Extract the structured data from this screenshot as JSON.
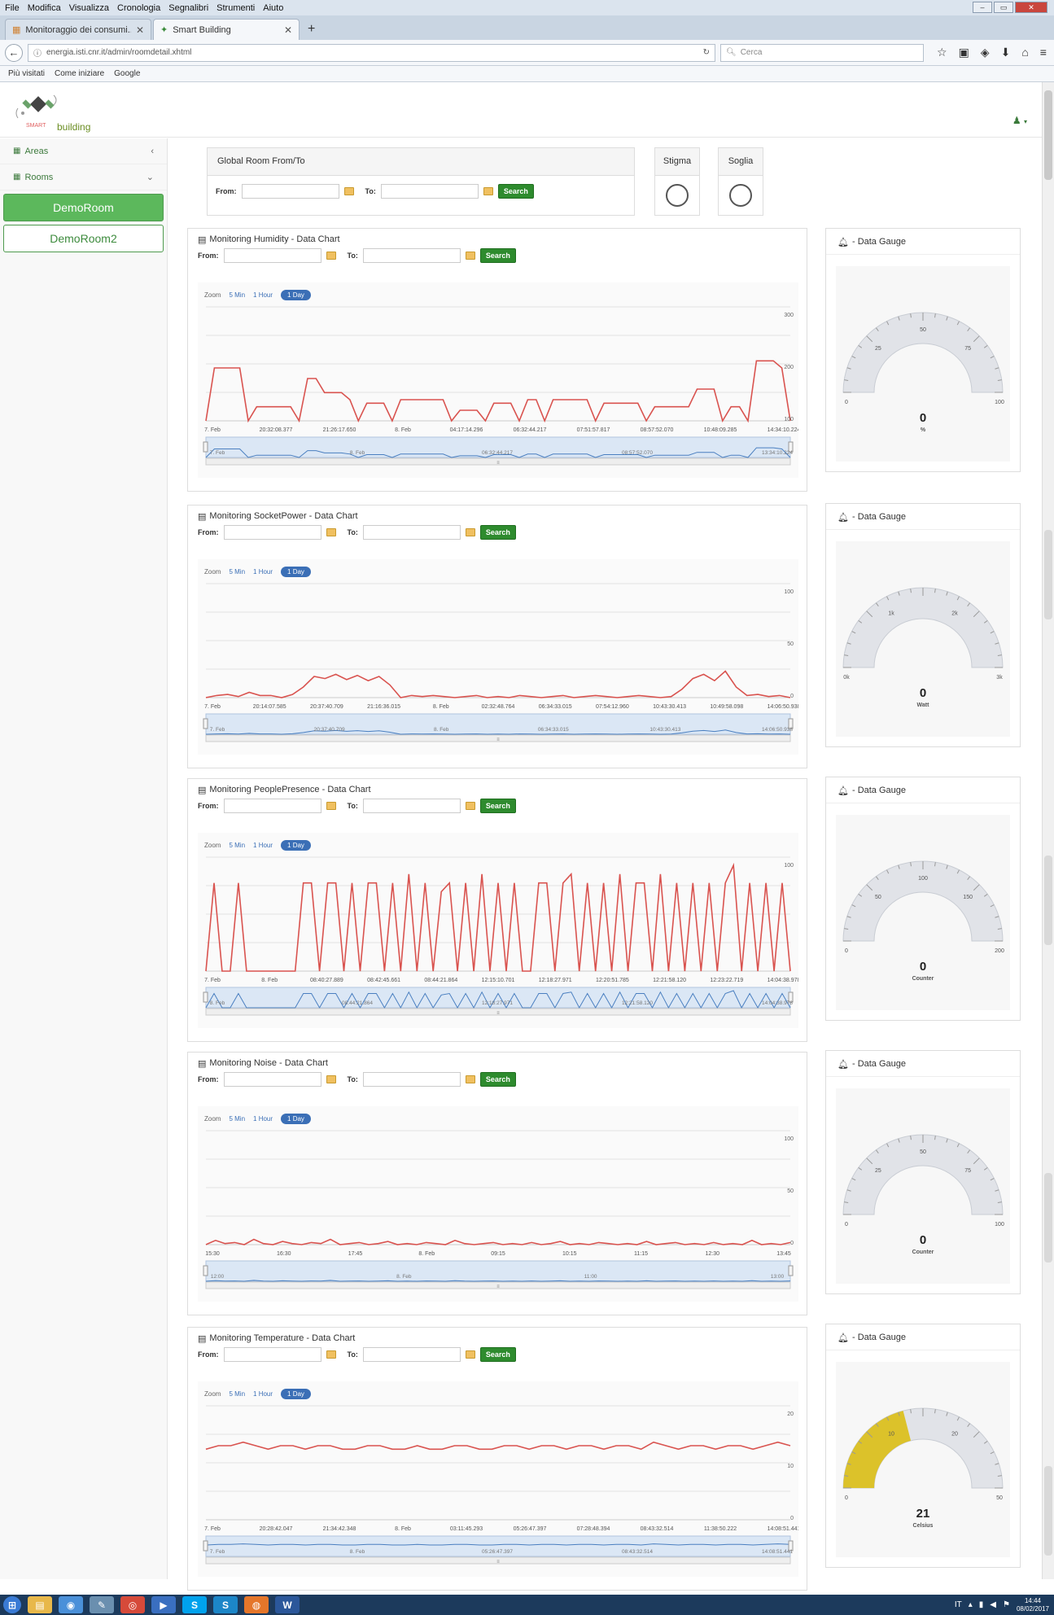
{
  "browser": {
    "menu": [
      "File",
      "Modifica",
      "Visualizza",
      "Cronologia",
      "Segnalibri",
      "Strumenti",
      "Aiuto"
    ],
    "tabs": [
      {
        "label": "Monitoraggio dei consumi...",
        "icon": "grid-icon"
      },
      {
        "label": "Smart Building",
        "icon": "tree-icon"
      }
    ],
    "url": "energia.isti.cnr.it/admin/roomdetail.xhtml",
    "search_placeholder": "Cerca",
    "bookmarks": [
      "Più visitati",
      "Come iniziare",
      "Google"
    ]
  },
  "app": {
    "logo_word": "building",
    "logo_smart": "SMART"
  },
  "sidebar": {
    "areas_label": "Areas",
    "rooms_label": "Rooms",
    "rooms": [
      "DemoRoom",
      "DemoRoom2"
    ]
  },
  "global": {
    "title": "Global Room From/To",
    "from_label": "From:",
    "to_label": "To:",
    "search_label": "Search",
    "stigma_label": "Stigma",
    "soglia_label": "Soglia"
  },
  "zoom": {
    "label": "Zoom",
    "options": [
      "5 Min",
      "1 Hour",
      "1 Day"
    ],
    "selected": "1 Day"
  },
  "panels": [
    {
      "title": "Monitoring Humidity - Data Chart",
      "gauge_title": "- Data Gauge",
      "yticks": [
        "300",
        "200",
        "100"
      ],
      "xticks": [
        "7. Feb",
        "20:32:08.377",
        "21:26:17.650",
        "8. Feb",
        "04:17:14.296",
        "06:32:44.217",
        "07:51:57.817",
        "08:57:52.070",
        "10:48:09.285",
        "14:34:10.224"
      ],
      "nav_labels": [
        "7. Feb",
        "8. Feb",
        "06:32:44.217",
        "08:57:52.070",
        "13:34:10.224"
      ],
      "gauge": {
        "value": "0",
        "unit": "%",
        "min": "0",
        "max": "100",
        "ticks": [
          "25",
          "50",
          "75"
        ],
        "fill": 0
      }
    },
    {
      "title": "Monitoring SocketPower - Data Chart",
      "gauge_title": "- Data Gauge",
      "yticks": [
        "100",
        "50",
        "0"
      ],
      "xticks": [
        "7. Feb",
        "20:14:07.585",
        "20:37:40.709",
        "21:16:36.015",
        "8. Feb",
        "02:32:48.764",
        "06:34:33.015",
        "07:54:12.960",
        "10:43:30.413",
        "10:49:58.098",
        "14:06:50.938"
      ],
      "nav_labels": [
        "7. Feb",
        "20:37:40.709",
        "8. Feb",
        "06:34:33.015",
        "10:43:30.413",
        "14:06:50.938"
      ],
      "gauge": {
        "value": "0",
        "unit": "Watt",
        "min": "0k",
        "max": "3k",
        "ticks": [
          "1k",
          "2k"
        ],
        "fill": 0
      }
    },
    {
      "title": "Monitoring PeoplePresence - Data Chart",
      "gauge_title": "- Data Gauge",
      "yticks": [
        "100"
      ],
      "xticks": [
        "7. Feb",
        "8. Feb",
        "08:40:27.889",
        "08:42:45.661",
        "08:44:21.864",
        "12:15:10.701",
        "12:18:27.971",
        "12:20:51.785",
        "12:21:58.120",
        "12:23:22.719",
        "14:04:38.978"
      ],
      "nav_labels": [
        "8. Feb",
        "08:44:21.864",
        "12:18:27.971",
        "12:21:58.120",
        "14:04:38.978"
      ],
      "gauge": {
        "value": "0",
        "unit": "Counter",
        "min": "0",
        "max": "200",
        "ticks": [
          "50",
          "100",
          "150"
        ],
        "fill": 0
      }
    },
    {
      "title": "Monitoring Noise - Data Chart",
      "gauge_title": "- Data Gauge",
      "yticks": [
        "100",
        "50",
        "0"
      ],
      "xticks": [
        "15:30",
        "16:30",
        "17:45",
        "8. Feb",
        "09:15",
        "10:15",
        "11:15",
        "12:30",
        "13:45"
      ],
      "nav_labels": [
        "12:00",
        "8. Feb",
        "11:00",
        "13:00"
      ],
      "gauge": {
        "value": "0",
        "unit": "Counter",
        "min": "0",
        "max": "100",
        "ticks": [
          "25",
          "50",
          "75"
        ],
        "fill": 0
      }
    },
    {
      "title": "Monitoring Temperature - Data Chart",
      "gauge_title": "- Data Gauge",
      "yticks": [
        "20",
        "10",
        "0"
      ],
      "xticks": [
        "7. Feb",
        "20:28:42.047",
        "21:34:42.348",
        "8. Feb",
        "03:11:45.293",
        "05:26:47.397",
        "07:28:48.394",
        "08:43:32.514",
        "11:38:50.222",
        "14:08:51.441"
      ],
      "nav_labels": [
        "7. Feb",
        "8. Feb",
        "05:26:47.397",
        "08:43:32.514",
        "14:08:51.441"
      ],
      "gauge": {
        "value": "21",
        "unit": "Celsius",
        "min": "0",
        "max": "50",
        "ticks": [
          "10",
          "20"
        ],
        "fill": 0.42
      }
    }
  ],
  "chart_data": [
    {
      "type": "line",
      "title": "Monitoring Humidity - Data Chart",
      "ylim": [
        0,
        300
      ],
      "series": [
        {
          "values": [
            0,
            150,
            150,
            150,
            150,
            0,
            40,
            40,
            40,
            40,
            40,
            0,
            120,
            120,
            80,
            80,
            80,
            60,
            0,
            50,
            50,
            50,
            0,
            60,
            60,
            60,
            60,
            60,
            60,
            0,
            30,
            30,
            30,
            0,
            50,
            50,
            50,
            0,
            60,
            60,
            0,
            60,
            60,
            60,
            60,
            60,
            0,
            50,
            50,
            50,
            50,
            50,
            0,
            40,
            40,
            40,
            40,
            40,
            90,
            90,
            90,
            0,
            40,
            40,
            0,
            170,
            170,
            170,
            150,
            0
          ]
        }
      ]
    },
    {
      "type": "line",
      "title": "Monitoring SocketPower - Data Chart",
      "ylim": [
        0,
        100
      ],
      "series": [
        {
          "values": [
            0,
            2,
            3,
            1,
            5,
            2,
            2,
            0,
            3,
            10,
            20,
            18,
            22,
            17,
            21,
            16,
            20,
            12,
            0,
            2,
            1,
            2,
            1,
            0,
            1,
            2,
            0,
            1,
            0,
            2,
            1,
            0,
            1,
            2,
            0,
            1,
            2,
            1,
            0,
            1,
            2,
            1,
            0,
            1,
            8,
            18,
            22,
            16,
            25,
            10,
            2,
            3,
            1,
            2,
            0
          ]
        }
      ]
    },
    {
      "type": "line",
      "title": "Monitoring PeoplePresence - Data Chart",
      "ylim": [
        0,
        120
      ],
      "series": [
        {
          "values": [
            0,
            100,
            0,
            0,
            100,
            0,
            0,
            0,
            0,
            0,
            0,
            0,
            100,
            100,
            0,
            100,
            100,
            0,
            100,
            0,
            100,
            100,
            0,
            100,
            0,
            110,
            0,
            100,
            0,
            90,
            100,
            0,
            100,
            0,
            110,
            0,
            100,
            0,
            100,
            0,
            0,
            100,
            100,
            0,
            100,
            110,
            0,
            100,
            0,
            100,
            0,
            110,
            0,
            100,
            100,
            0,
            110,
            0,
            100,
            0,
            100,
            0,
            100,
            0,
            100,
            120,
            0,
            100,
            0,
            100,
            0,
            100,
            0
          ]
        }
      ]
    },
    {
      "type": "line",
      "title": "Monitoring Noise - Data Chart",
      "ylim": [
        0,
        100
      ],
      "series": [
        {
          "values": [
            0,
            4,
            1,
            2,
            0,
            5,
            1,
            0,
            3,
            1,
            0,
            2,
            1,
            5,
            0,
            1,
            2,
            0,
            1,
            3,
            0,
            1,
            0,
            2,
            1,
            0,
            4,
            1,
            0,
            1,
            2,
            0,
            1,
            0,
            2,
            0,
            1,
            3,
            0,
            1,
            0,
            2,
            1,
            0,
            1,
            0,
            3,
            0,
            1,
            2,
            0,
            1,
            0,
            2,
            0,
            1,
            0,
            4,
            0,
            1,
            0,
            2
          ]
        }
      ]
    },
    {
      "type": "line",
      "title": "Monitoring Temperature - Data Chart",
      "ylim": [
        0,
        30
      ],
      "series": [
        {
          "values": [
            20,
            21,
            21,
            22,
            21,
            20,
            21,
            21,
            20,
            21,
            21,
            20,
            20,
            21,
            21,
            20,
            20,
            21,
            20,
            20,
            21,
            21,
            20,
            20,
            21,
            21,
            20,
            21,
            21,
            20,
            21,
            21,
            20,
            21,
            21,
            20,
            22,
            21,
            20,
            21,
            21,
            20,
            21,
            21,
            20,
            21,
            22,
            21
          ]
        }
      ]
    }
  ],
  "taskbar": {
    "apps": [
      "start",
      "explorer",
      "chrome-app",
      "paint",
      "chrome",
      "media",
      "skype",
      "skype-b",
      "firefox",
      "word"
    ],
    "tray_lang": "IT",
    "time": "14:44",
    "date": "08/02/2017"
  }
}
